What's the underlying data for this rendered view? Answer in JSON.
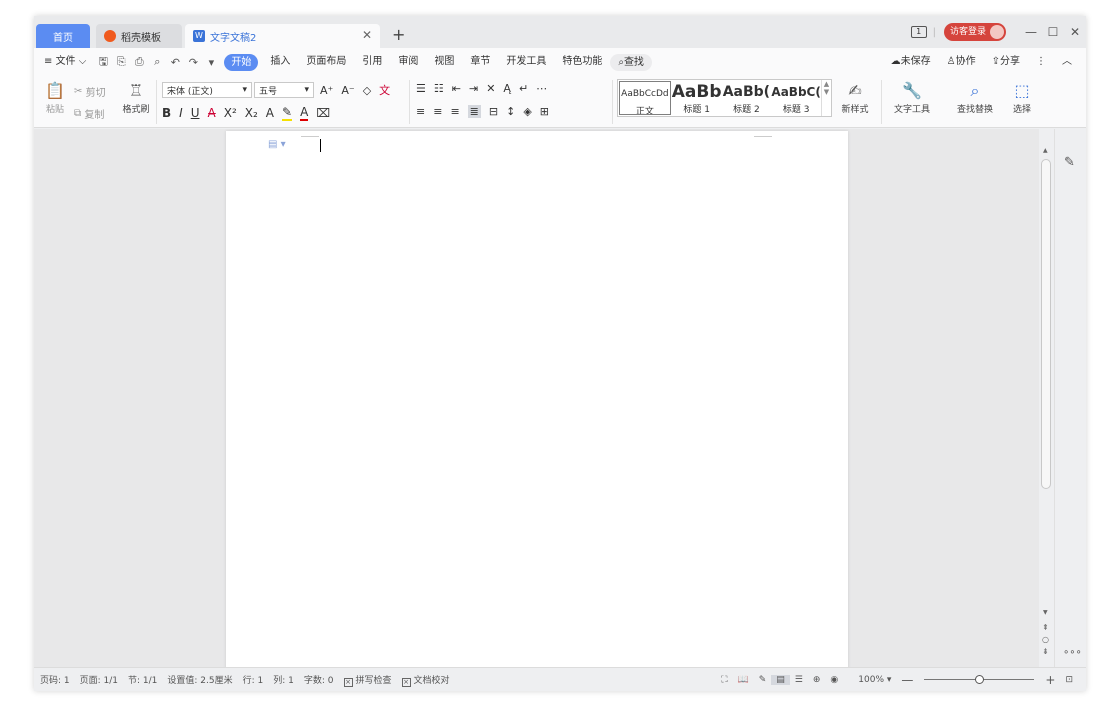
{
  "tabs": [
    {
      "label": "首页",
      "icon": "home-tab-icon"
    },
    {
      "label": "稻壳模板",
      "icon": "docer-logo-icon"
    },
    {
      "label": "文字文稿2",
      "icon": "wps-writer-icon"
    }
  ],
  "titlebar": {
    "login_label": "访客登录",
    "book_icon": "1"
  },
  "menu": {
    "file_label": "文件",
    "tabs": [
      "开始",
      "插入",
      "页面布局",
      "引用",
      "审阅",
      "视图",
      "章节",
      "开发工具",
      "特色功能"
    ],
    "active_tab": "开始",
    "search_label": "查找",
    "unsaved_label": "未保存",
    "collab_label": "协作",
    "share_label": "分享"
  },
  "ribbon": {
    "paste_label": "粘贴",
    "cut_label": "剪切",
    "copy_label": "复制",
    "format_painter_label": "格式刷",
    "font_name": "宋体 (正文)",
    "font_size": "五号",
    "styles": [
      {
        "preview": "AaBbCcDd",
        "label": "正文"
      },
      {
        "preview": "AaBb",
        "label": "标题 1"
      },
      {
        "preview": "AaBb(",
        "label": "标题 2"
      },
      {
        "preview": "AaBbC(",
        "label": "标题 3"
      }
    ],
    "new_style_label": "新样式",
    "text_tools_label": "文字工具",
    "find_replace_label": "查找替换",
    "select_label": "选择"
  },
  "status": {
    "page_num": "页码: 1",
    "pages": "页面: 1/1",
    "section": "节: 1/1",
    "setting": "设置值: 2.5厘米",
    "row": "行: 1",
    "col": "列: 1",
    "word_count": "字数: 0",
    "spell_check": "拼写检查",
    "proofread": "文档校对",
    "zoom": "100%",
    "zoom_fraction": 0.5
  },
  "colors": {
    "accent": "#5b8cf2",
    "login": "#d5443c",
    "wps_blue": "#3a73d8",
    "docer_orange": "#f05a1e"
  }
}
